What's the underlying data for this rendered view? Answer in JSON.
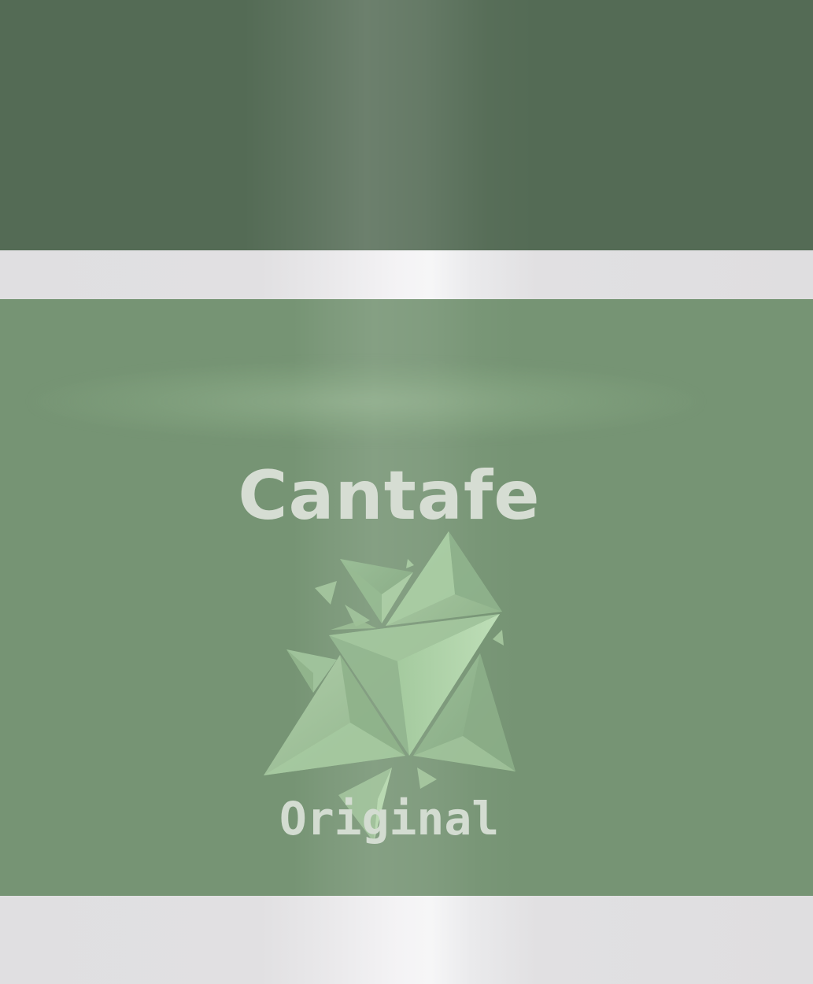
{
  "label": {
    "brand": "Cantafe",
    "variant": "Original"
  },
  "colors": {
    "cap_green": "#546b55",
    "panel_green": "#769474",
    "band_silver": "#e3e2e4",
    "text_light": "#d6ddd3",
    "emblem_light": "#b2d6ad"
  },
  "icons": {
    "emblem": "faceted-triangle-crystal-logo"
  }
}
